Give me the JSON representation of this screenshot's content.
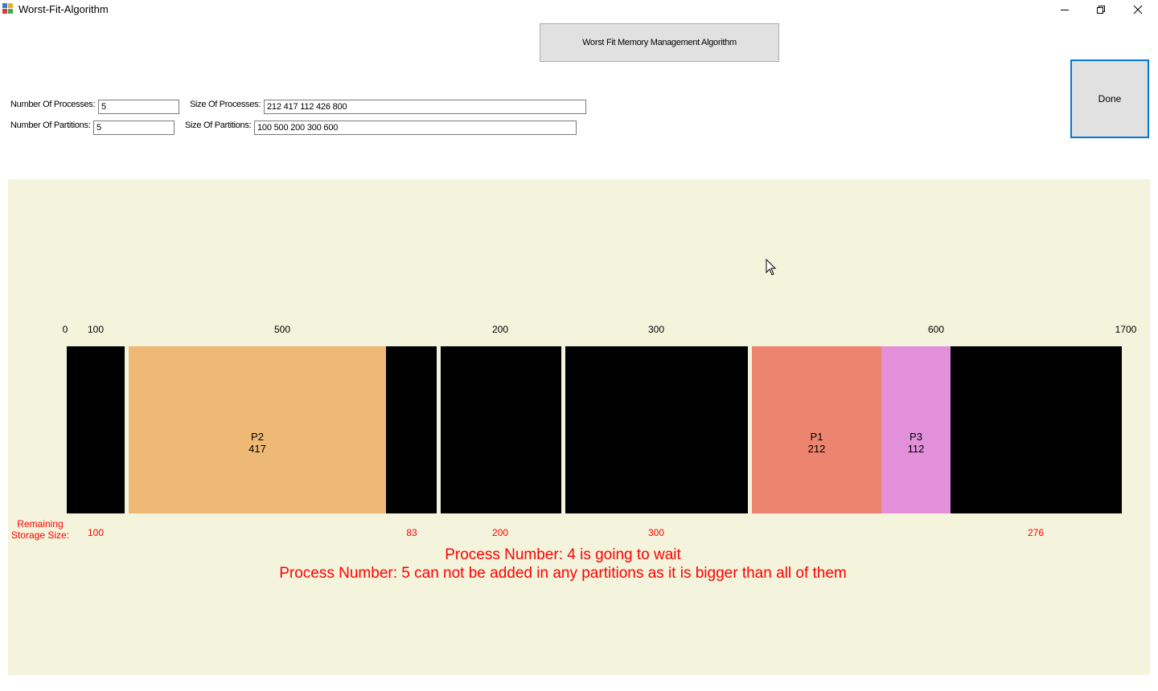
{
  "window": {
    "title": "Worst-Fit-Algorithm",
    "controls": [
      "minimize-icon",
      "restore-icon",
      "close-icon"
    ]
  },
  "header": {
    "title_button": "Worst Fit Memory Management Algorithm",
    "done_button": "Done"
  },
  "inputs": {
    "num_processes_label": "Number Of Processes:",
    "num_processes_value": "5",
    "size_processes_label": "Size Of Processes:",
    "size_processes_value": "212 417 112 426 800",
    "num_partitions_label": "Number Of Partitions:",
    "num_partitions_value": "5",
    "size_partitions_label": "Size Of Partitions:",
    "size_partitions_value": "100 500 200 300 600"
  },
  "memory_map": {
    "start_label": "0",
    "end_label": "1700",
    "partition_labels": [
      "100",
      "500",
      "200",
      "300",
      "600"
    ],
    "blocks": [
      {
        "name": "P2",
        "size": "417",
        "color": "#eeb974"
      },
      {
        "name": "P1",
        "size": "212",
        "color": "#ec8470"
      },
      {
        "name": "P3",
        "size": "112",
        "color": "#e290da"
      }
    ],
    "free_color": "#000000",
    "remaining_title": "Remaining Storage Size:",
    "remaining_values": [
      "100",
      "83",
      "200",
      "300",
      "276"
    ]
  },
  "messages": [
    "Process Number: 4 is going to wait",
    "Process Number: 5 can not be added in any partitions as it is bigger than all of them"
  ],
  "colors": {
    "panel_background": "#f4f3dc",
    "message_color": "#ff0000",
    "done_border": "#0078d7"
  }
}
